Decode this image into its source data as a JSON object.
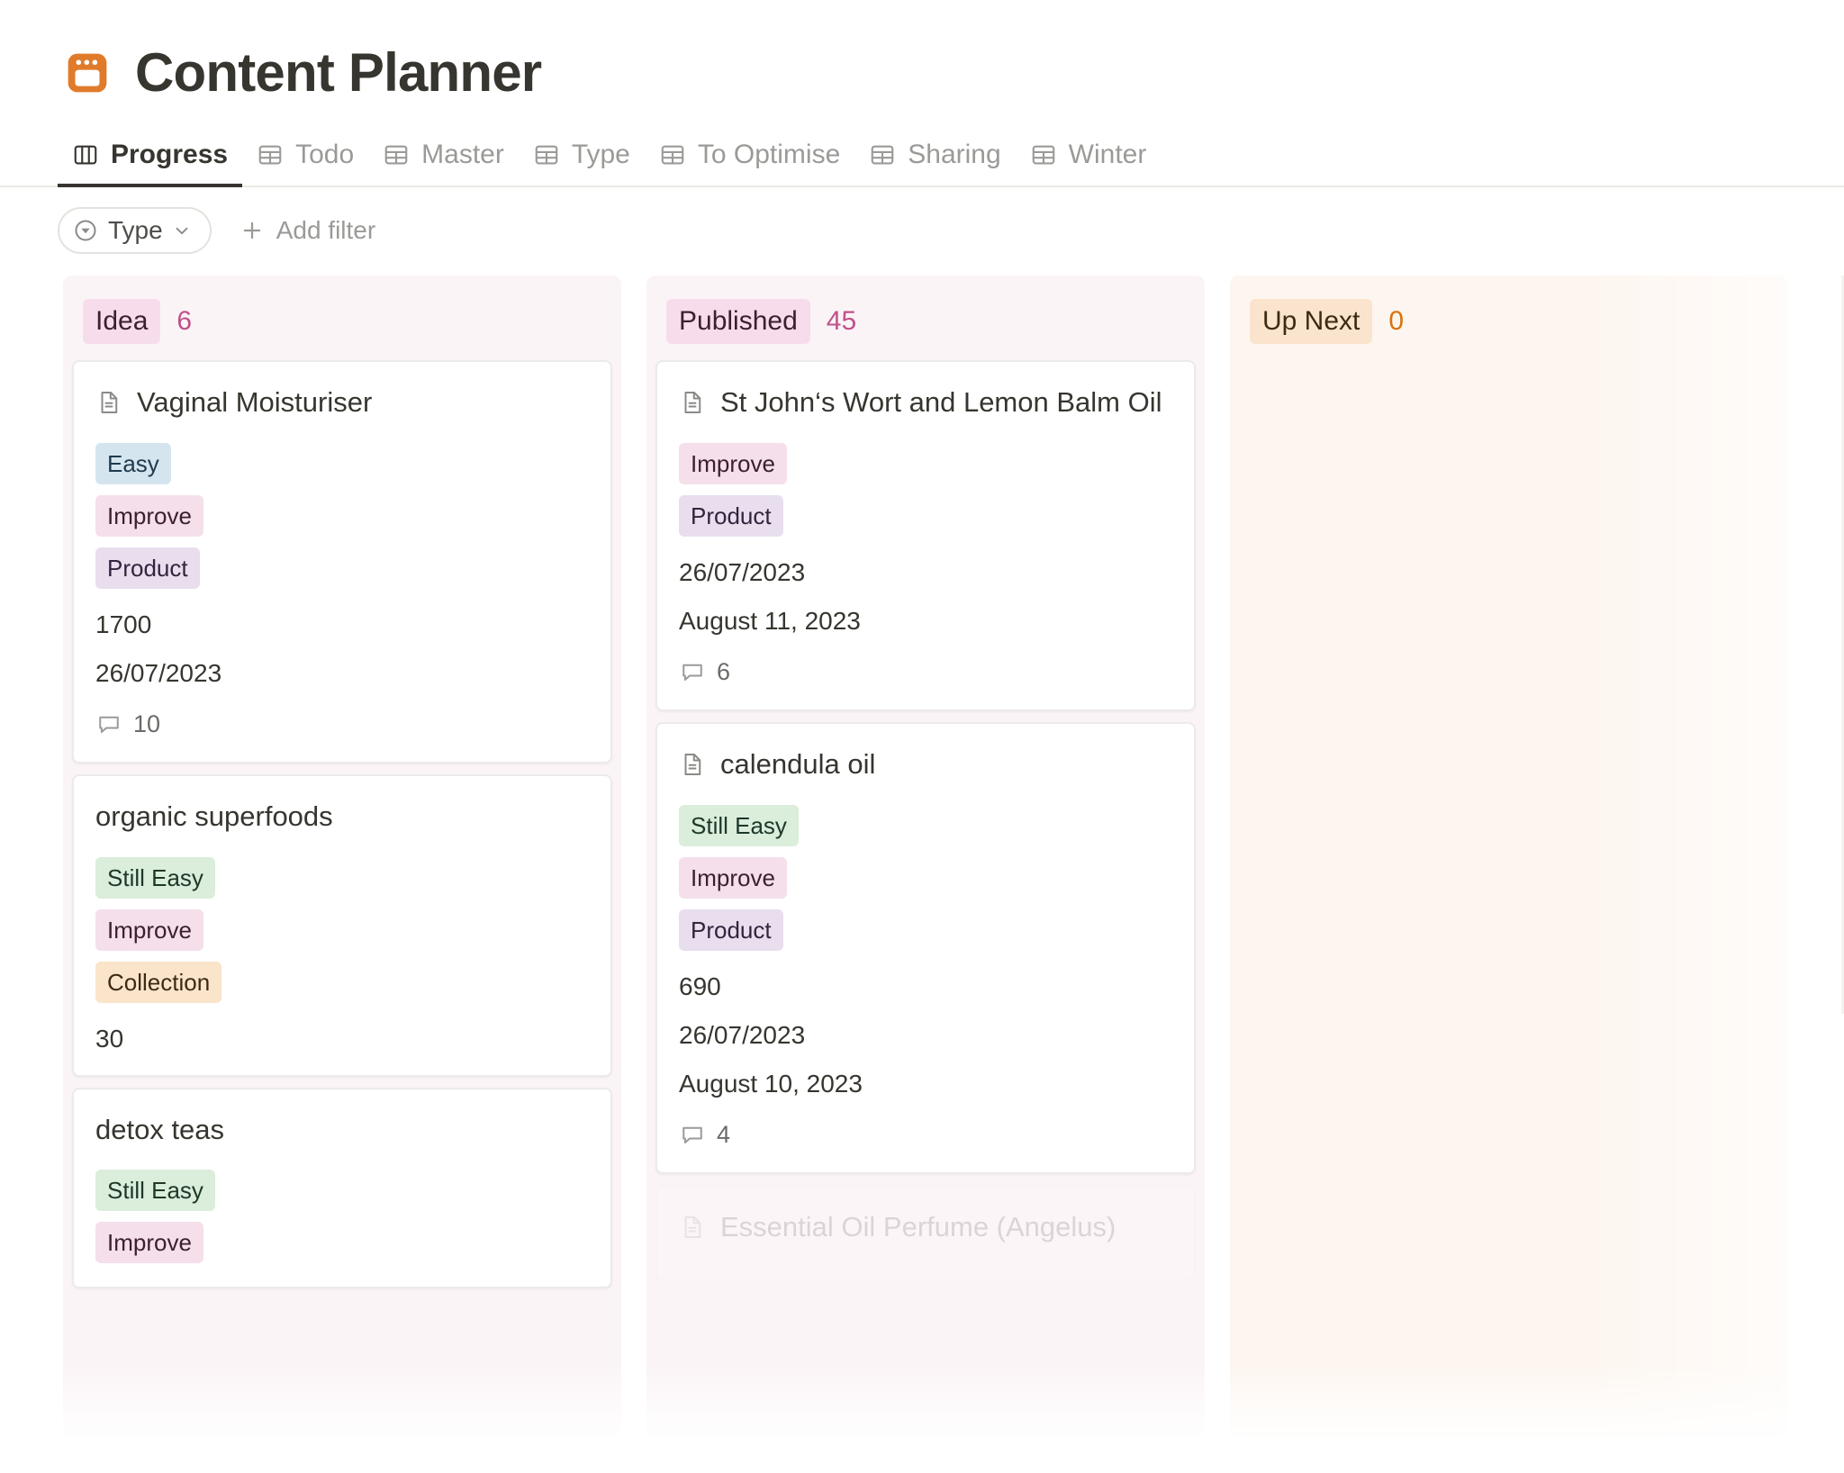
{
  "header": {
    "icon": "database-window-icon",
    "icon_color": "#e07b2b",
    "title": "Content Planner"
  },
  "tabs": [
    {
      "label": "Progress",
      "icon": "board-view-icon",
      "active": true
    },
    {
      "label": "Todo",
      "icon": "table-view-icon",
      "active": false
    },
    {
      "label": "Master",
      "icon": "table-view-icon",
      "active": false
    },
    {
      "label": "Type",
      "icon": "table-view-icon",
      "active": false
    },
    {
      "label": "To Optimise",
      "icon": "table-view-icon",
      "active": false
    },
    {
      "label": "Sharing",
      "icon": "table-view-icon",
      "active": false
    },
    {
      "label": "Winter",
      "icon": "table-view-icon",
      "active": false
    }
  ],
  "filterbar": {
    "filter_pill": {
      "label": "Type",
      "icon": "select-property-icon",
      "chevron": "chevron-down-icon"
    },
    "add_filter": {
      "label": "Add filter",
      "icon": "plus-icon"
    }
  },
  "board": {
    "columns": [
      {
        "name": "Idea",
        "count": "6",
        "tone": "pink",
        "cards": [
          {
            "title": "Vaginal Moisturiser",
            "has_doc_icon": true,
            "tags": [
              {
                "label": "Easy",
                "color": "blue"
              },
              {
                "label": "Improve",
                "color": "pink"
              },
              {
                "label": "Product",
                "color": "purple"
              }
            ],
            "props": [
              "1700",
              "26/07/2023"
            ],
            "comments": "10",
            "ghost": false
          },
          {
            "title": "organic superfoods",
            "has_doc_icon": false,
            "tags": [
              {
                "label": "Still Easy",
                "color": "green"
              },
              {
                "label": "Improve",
                "color": "pink"
              },
              {
                "label": "Collection",
                "color": "orange"
              }
            ],
            "props": [
              "30"
            ],
            "comments": null,
            "ghost": false
          },
          {
            "title": "detox teas",
            "has_doc_icon": false,
            "tags": [
              {
                "label": "Still Easy",
                "color": "green"
              },
              {
                "label": "Improve",
                "color": "pink"
              }
            ],
            "props": [],
            "comments": null,
            "ghost": false
          }
        ]
      },
      {
        "name": "Published",
        "count": "45",
        "tone": "pink",
        "cards": [
          {
            "title": "St John‘s Wort and Lemon Balm Oil",
            "has_doc_icon": true,
            "tags": [
              {
                "label": "Improve",
                "color": "pink"
              },
              {
                "label": "Product",
                "color": "purple"
              }
            ],
            "props": [
              "26/07/2023",
              "August 11, 2023"
            ],
            "comments": "6",
            "ghost": false
          },
          {
            "title": "calendula oil",
            "has_doc_icon": true,
            "tags": [
              {
                "label": "Still Easy",
                "color": "green"
              },
              {
                "label": "Improve",
                "color": "pink"
              },
              {
                "label": "Product",
                "color": "purple"
              }
            ],
            "props": [
              "690",
              "26/07/2023",
              "August 10, 2023"
            ],
            "comments": "4",
            "ghost": false
          },
          {
            "title": "Essential Oil Perfume (Angelus)",
            "has_doc_icon": true,
            "tags": [],
            "props": [],
            "comments": null,
            "ghost": true
          }
        ]
      },
      {
        "name": "Up Next",
        "count": "0",
        "tone": "peach",
        "cards": []
      }
    ]
  }
}
